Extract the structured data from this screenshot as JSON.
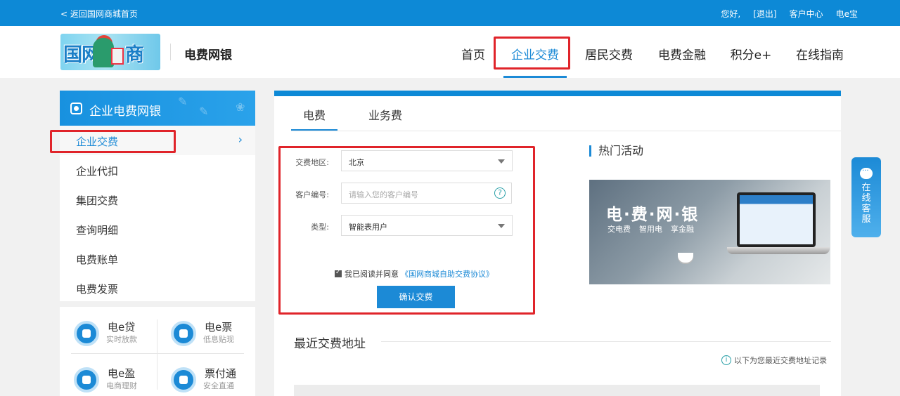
{
  "topbar": {
    "back_link": "< 返回国网商城首页",
    "greeting": "您好,",
    "logout": "[退出]",
    "customer_center": "客户中心",
    "e_bao": "电e宝"
  },
  "header": {
    "brand": "电费网银",
    "nav": [
      "首页",
      "企业交费",
      "居民交费",
      "电费金融",
      "积分e+",
      "在线指南"
    ],
    "active_nav": "企业交费"
  },
  "sidebar": {
    "title": "企业电费网银",
    "items": [
      "企业交费",
      "企业代扣",
      "集团交费",
      "查询明细",
      "电费账单",
      "电费发票"
    ],
    "active_item": "企业交费"
  },
  "services": [
    {
      "name": "电e贷",
      "sub": "实时放款"
    },
    {
      "name": "电e票",
      "sub": "低息贴现"
    },
    {
      "name": "电e盈",
      "sub": "电商理财"
    },
    {
      "name": "票付通",
      "sub": "安全直通"
    }
  ],
  "main": {
    "tabs": [
      "电费",
      "业务费"
    ],
    "form": {
      "region_label": "交费地区:",
      "region_value": "北京",
      "customer_label": "客户编号:",
      "customer_placeholder": "请输入您的客户编号",
      "help": "?",
      "type_label": "类型:",
      "type_value": "智能表用户",
      "agree_text": "我已阅读并同意",
      "agree_link": "《国网商城自助交费协议》",
      "confirm": "确认交费"
    },
    "hot": {
      "title": "热门活动",
      "banner_big": "电·费·网·银",
      "banner_tags": [
        "交电费",
        "智用电",
        "享金融"
      ]
    },
    "recent": {
      "title": "最近交费地址",
      "note": "以下为您最近交费地址记录",
      "note_icon": "i"
    }
  },
  "float_service": "在线客服",
  "colors": {
    "primary": "#0d89d6",
    "accent": "#1c8ad6",
    "highlight": "#e0242a"
  }
}
